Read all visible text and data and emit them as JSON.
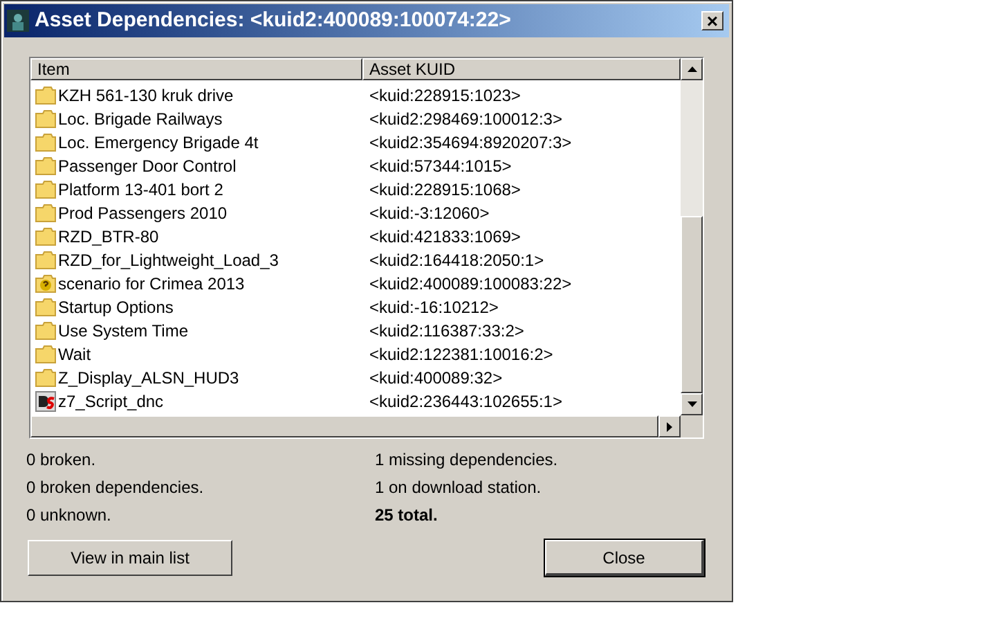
{
  "window": {
    "title": "Asset Dependencies: <kuid2:400089:100074:22>",
    "close": "×"
  },
  "table": {
    "columns": [
      "Item",
      "Asset KUID"
    ],
    "rows": [
      {
        "kind": "folder",
        "item": "KZH 561-130 kruk drive",
        "kuid": "<kuid:228915:1023>"
      },
      {
        "kind": "folder",
        "item": "Loc. Brigade Railways",
        "kuid": "<kuid2:298469:100012:3>"
      },
      {
        "kind": "folder",
        "item": "Loc. Emergency Brigade 4t",
        "kuid": "<kuid2:354694:8920207:3>"
      },
      {
        "kind": "folder",
        "item": "Passenger Door Control",
        "kuid": "<kuid:57344:1015>"
      },
      {
        "kind": "folder",
        "item": "Platform 13-401 bort 2",
        "kuid": "<kuid:228915:1068>"
      },
      {
        "kind": "folder",
        "item": "Prod Passengers 2010",
        "kuid": "<kuid:-3:12060>"
      },
      {
        "kind": "folder",
        "item": "RZD_BTR-80",
        "kuid": "<kuid:421833:1069>"
      },
      {
        "kind": "folder",
        "item": "RZD_for_Lightweight_Load_3",
        "kuid": "<kuid2:164418:2050:1>"
      },
      {
        "kind": "missing",
        "item": "scenario for Crimea 2013",
        "kuid": "<kuid2:400089:100083:22>"
      },
      {
        "kind": "folder",
        "item": "Startup Options",
        "kuid": "<kuid:-16:10212>"
      },
      {
        "kind": "folder",
        "item": "Use System Time",
        "kuid": "<kuid2:116387:33:2>"
      },
      {
        "kind": "folder",
        "item": "Wait",
        "kuid": "<kuid2:122381:10016:2>"
      },
      {
        "kind": "folder",
        "item": "Z_Display_ALSN_HUD3",
        "kuid": "<kuid:400089:32>"
      },
      {
        "kind": "script",
        "item": "z7_Script_dnc",
        "kuid": "<kuid2:236443:102655:1>"
      }
    ]
  },
  "stats_left": [
    {
      "text": "0 broken.",
      "bold": false
    },
    {
      "text": "0 broken dependencies.",
      "bold": false
    },
    {
      "text": "0 unknown.",
      "bold": false
    }
  ],
  "stats_right": [
    {
      "text": "1 missing dependencies.",
      "bold": false
    },
    {
      "text": "1 on download station.",
      "bold": false
    },
    {
      "text": "25 total.",
      "bold": true
    }
  ],
  "buttons": [
    {
      "label": "View in main list",
      "default": false
    },
    {
      "label": "Close",
      "default": true
    }
  ]
}
